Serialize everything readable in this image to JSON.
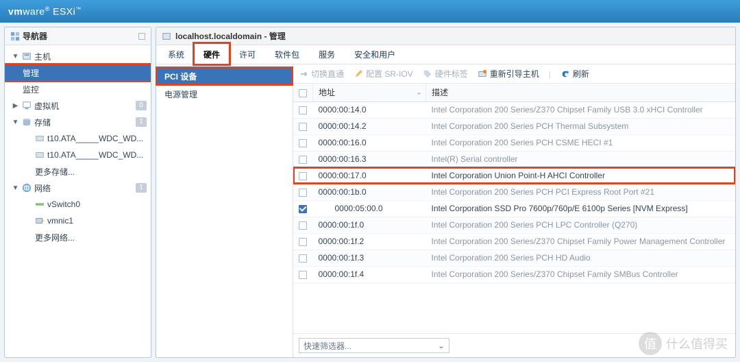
{
  "brand_html": "vmware ESXi",
  "navigator": {
    "title": "导航器",
    "host": "主机",
    "manage": "管理",
    "monitor": "监控",
    "vms": "虚拟机",
    "storage": "存储",
    "disk1": "t10.ATA_____WDC_WD...",
    "disk2": "t10.ATA_____WDC_WD...",
    "more_storage": "更多存储...",
    "networking": "网络",
    "vswitch": "vSwitch0",
    "vmnic": "vmnic1",
    "more_net": "更多网络...",
    "vm_count": "0",
    "storage_count": "1",
    "net_count": "1"
  },
  "content": {
    "title": "localhost.localdomain - 管理"
  },
  "tabs": [
    "系统",
    "硬件",
    "许可",
    "软件包",
    "服务",
    "安全和用户"
  ],
  "hw_side": {
    "pci": "PCI 设备",
    "power": "电源管理"
  },
  "toolbar": {
    "passthrough": "切换直通",
    "sriov": "配置 SR-IOV",
    "label": "硬件标签",
    "reboot": "重新引导主机",
    "refresh": "刷新"
  },
  "cols": {
    "addr": "地址",
    "desc": "描述"
  },
  "filter": "快速筛选器...",
  "rows": [
    {
      "addr": "0000:00:14.0",
      "desc": "Intel Corporation 200 Series/Z370 Chipset Family USB 3.0 xHCI Controller",
      "dim": true,
      "checked": false,
      "indent": 0
    },
    {
      "addr": "0000:00:14.2",
      "desc": "Intel Corporation 200 Series PCH Thermal Subsystem",
      "dim": true,
      "checked": false,
      "indent": 0
    },
    {
      "addr": "0000:00:16.0",
      "desc": "Intel Corporation 200 Series PCH CSME HECI #1",
      "dim": true,
      "checked": false,
      "indent": 0
    },
    {
      "addr": "0000:00:16.3",
      "desc": "Intel(R) Serial controller",
      "dim": true,
      "checked": false,
      "indent": 0
    },
    {
      "addr": "0000:00:17.0",
      "desc": "Intel Corporation Union Point-H AHCI Controller",
      "dim": false,
      "checked": false,
      "indent": 0,
      "outlined": true
    },
    {
      "addr": "0000:00:1b.0",
      "desc": "Intel Corporation 200 Series PCH PCI Express Root Port #21",
      "dim": true,
      "checked": false,
      "indent": 0
    },
    {
      "addr": "0000:05:00.0",
      "desc": "Intel Corporation SSD Pro 7600p/760p/E 6100p Series [NVM Express]",
      "dim": false,
      "checked": true,
      "indent": 1
    },
    {
      "addr": "0000:00:1f.0",
      "desc": "Intel Corporation 200 Series PCH LPC Controller (Q270)",
      "dim": true,
      "checked": false,
      "indent": 0
    },
    {
      "addr": "0000:00:1f.2",
      "desc": "Intel Corporation 200 Series/Z370 Chipset Family Power Management Controller",
      "dim": true,
      "checked": false,
      "indent": 0
    },
    {
      "addr": "0000:00:1f.3",
      "desc": "Intel Corporation 200 Series PCH HD Audio",
      "dim": true,
      "checked": false,
      "indent": 0
    },
    {
      "addr": "0000:00:1f.4",
      "desc": "Intel Corporation 200 Series/Z370 Chipset Family SMBus Controller",
      "dim": true,
      "checked": false,
      "indent": 0
    }
  ],
  "watermark": "什么值得买"
}
